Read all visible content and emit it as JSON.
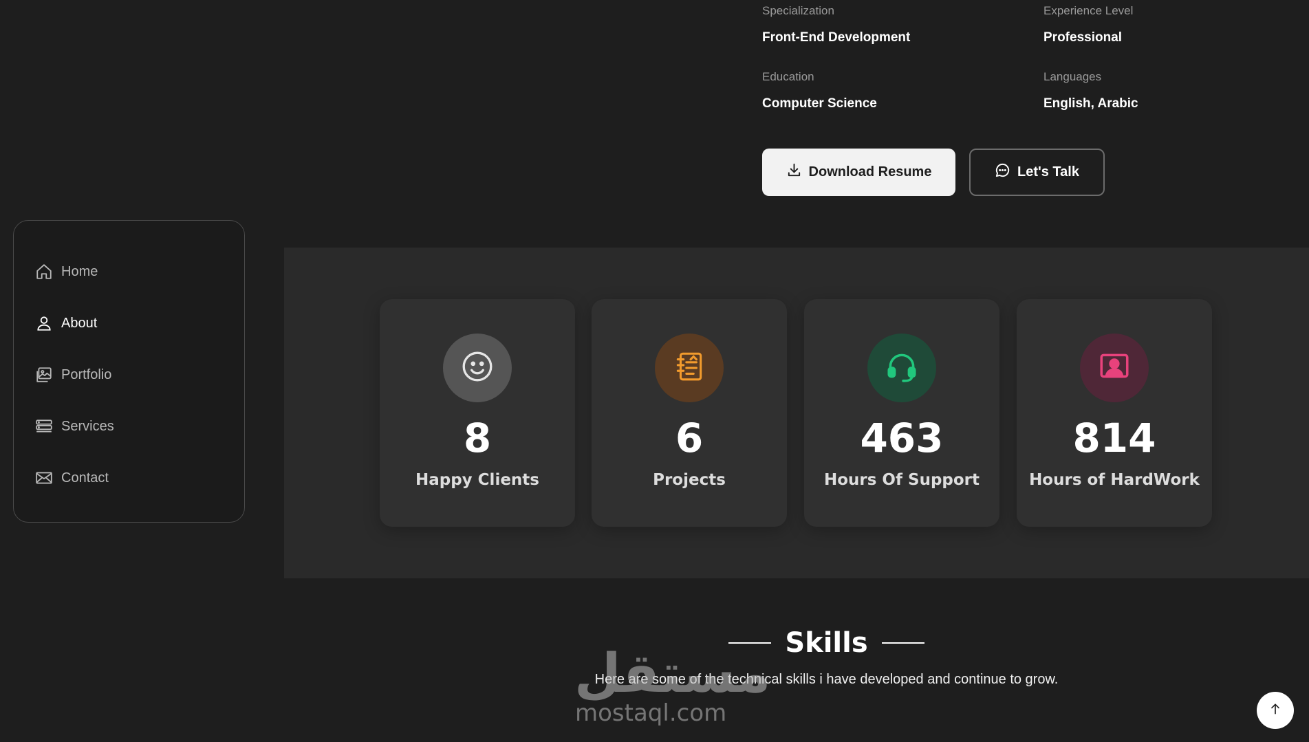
{
  "info": [
    {
      "label": "Specialization",
      "value": "Front-End Development"
    },
    {
      "label": "Experience Level",
      "value": "Professional"
    },
    {
      "label": "Education",
      "value": "Computer Science"
    },
    {
      "label": "Languages",
      "value": "English, Arabic"
    }
  ],
  "buttons": {
    "download": "Download Resume",
    "talk": "Let's Talk"
  },
  "sidebar": {
    "items": [
      {
        "label": "Home",
        "icon": "home-icon"
      },
      {
        "label": "About",
        "icon": "user-icon",
        "active": true
      },
      {
        "label": "Portfolio",
        "icon": "image-icon"
      },
      {
        "label": "Services",
        "icon": "server-icon"
      },
      {
        "label": "Contact",
        "icon": "mail-icon"
      }
    ]
  },
  "stats": [
    {
      "number": "8",
      "label": "Happy Clients",
      "icon": "smile-icon",
      "color": "#555555",
      "icon_color": "#e6e6e6"
    },
    {
      "number": "6",
      "label": "Projects",
      "icon": "notebook-icon",
      "color": "#5a3b22",
      "icon_color": "#f29b2d"
    },
    {
      "number": "463",
      "label": "Hours Of Support",
      "icon": "headset-icon",
      "color": "#1f4a38",
      "icon_color": "#21c77d"
    },
    {
      "number": "814",
      "label": "Hours of HardWork",
      "icon": "presenter-icon",
      "color": "#4f2737",
      "icon_color": "#e8427c"
    }
  ],
  "skills": {
    "title": "Skills",
    "description": "Here are some of the technical skills i have developed and continue to grow."
  },
  "watermark": {
    "arabic": "مستقل",
    "latin": "mostaql.com"
  }
}
